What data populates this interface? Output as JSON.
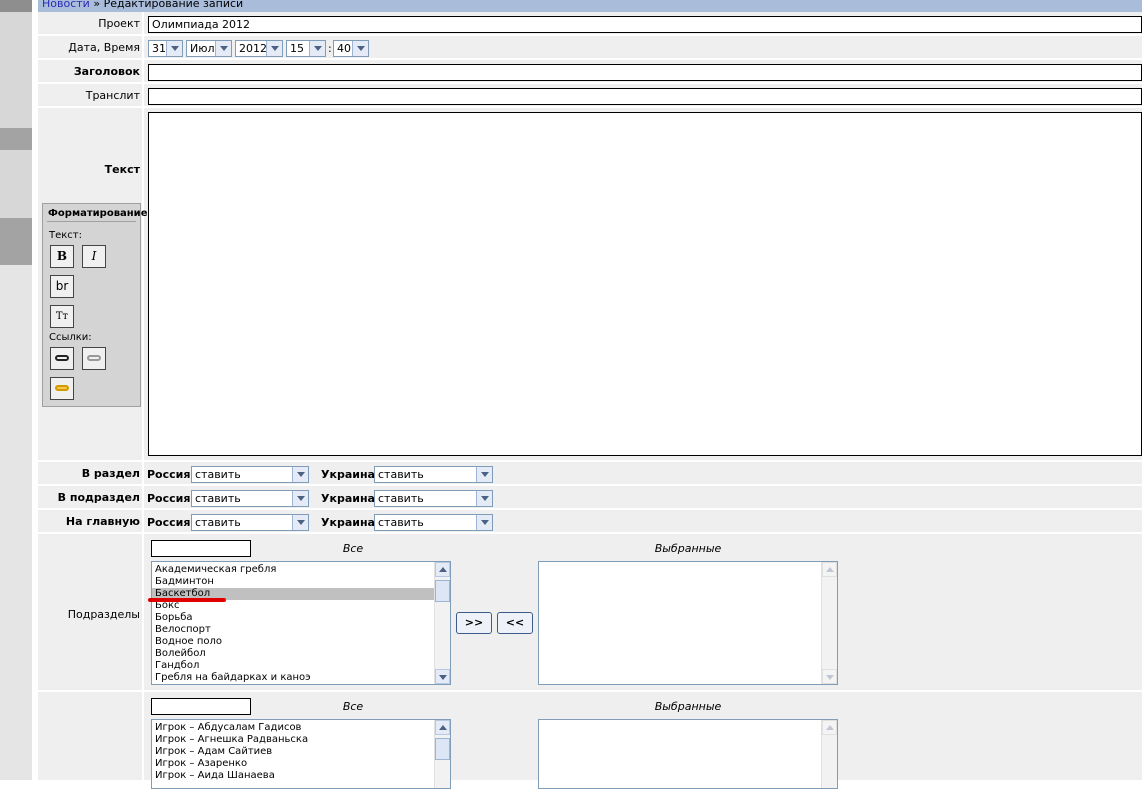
{
  "breadcrumb": {
    "link": "Новости",
    "sep": " » ",
    "current": "Редактирование записи"
  },
  "form": {
    "project": {
      "label": "Проект",
      "value": "Олимпиада 2012"
    },
    "datetime": {
      "label": "Дата, Время",
      "day": "31",
      "month": "Июл",
      "year": "2012",
      "hour": "15",
      "colon": ":",
      "minute": "40"
    },
    "title": {
      "label": "Заголовок",
      "value": ""
    },
    "translit": {
      "label": "Транслит",
      "value": ""
    },
    "text": {
      "label": "Текст",
      "value": ""
    },
    "formatting": {
      "title": "Форматирование",
      "text_caption": "Текст:",
      "bold": "B",
      "italic": "I",
      "br": "br",
      "typo": "Tт",
      "links_caption": "Ссылки:",
      "link_icon": "link-icon",
      "unlink_icon": "unlink-icon",
      "anchor_icon": "anchor-link-icon"
    },
    "section_rows": [
      {
        "label": "В раздел",
        "left_label": "Россия",
        "left_value": "ставить",
        "right_label": "Украина",
        "right_value": "ставить"
      },
      {
        "label": "В подраздел",
        "left_label": "Россия",
        "left_value": "ставить",
        "right_label": "Украина",
        "right_value": "ставить"
      },
      {
        "label": "На главную",
        "left_label": "Россия",
        "left_value": "ставить",
        "right_label": "Украина",
        "right_value": "ставить"
      }
    ],
    "subsections": {
      "label": "Подразделы",
      "all_header": "Все",
      "selected_header": "Выбранные",
      "add_button": ">>",
      "remove_button": "<<",
      "items": [
        "Академическая гребля",
        "Бадминтон",
        "Баскетбол",
        "Бокс",
        "Борьба",
        "Велоспорт",
        "Водное поло",
        "Волейбол",
        "Гандбол",
        "Гребля на байдарках и каноэ"
      ],
      "highlighted": "Баскетбол",
      "highlight_color": "#e00000"
    },
    "players": {
      "all_header": "Все",
      "selected_header": "Выбранные",
      "items": [
        "Игрок – Абдусалам Гадисов",
        "Игрок – Агнешка Радваньска",
        "Игрок – Адам Сайтиев",
        "Игрок – Азаренко",
        "Игрок – Аида Шанаева"
      ]
    }
  },
  "colors": {
    "topbar": "#a9bddb",
    "row_bg": "#efefef",
    "link": "#2b2bb5"
  }
}
